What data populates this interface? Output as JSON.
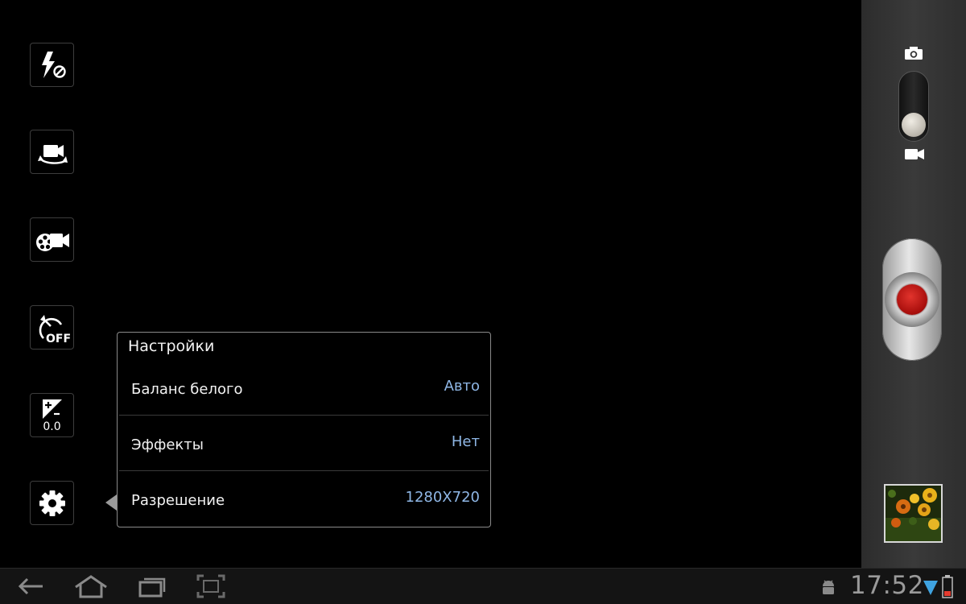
{
  "left_toolbar": {
    "items": [
      {
        "name": "flash-off-button",
        "icon": "flash-off-icon"
      },
      {
        "name": "switch-camera-button",
        "icon": "switch-camera-icon"
      },
      {
        "name": "recording-mode-button",
        "icon": "video-film-icon"
      },
      {
        "name": "timer-button",
        "icon": "timer-off-icon",
        "label": "OFF"
      },
      {
        "name": "exposure-button",
        "icon": "exposure-icon",
        "value": "0.0"
      },
      {
        "name": "settings-button",
        "icon": "gear-icon"
      }
    ]
  },
  "settings_popup": {
    "title": "Настройки",
    "rows": [
      {
        "label": "Баланс белого",
        "value": "Авто"
      },
      {
        "label": "Эффекты",
        "value": "Нет"
      },
      {
        "label": "Разрешение",
        "value": "1280X720"
      }
    ]
  },
  "right_panel": {
    "mode_switch": {
      "top_icon": "camera-icon",
      "bottom_icon": "video-camera-icon",
      "selected": "video"
    },
    "record_button": {
      "icon": "record-icon",
      "color": "#c0120f"
    },
    "gallery_thumbnail": {
      "icon": "gallery-thumbnail"
    }
  },
  "system_bar": {
    "nav": [
      "back-icon",
      "home-icon",
      "recent-apps-icon",
      "screenshot-icon"
    ],
    "clock": "17:52",
    "status_icons": [
      "android-debug-icon",
      "wifi-icon",
      "battery-icon"
    ]
  },
  "colors": {
    "accent_value": "#8fb7e6",
    "background": "#000000",
    "record_red": "#c0120f"
  }
}
